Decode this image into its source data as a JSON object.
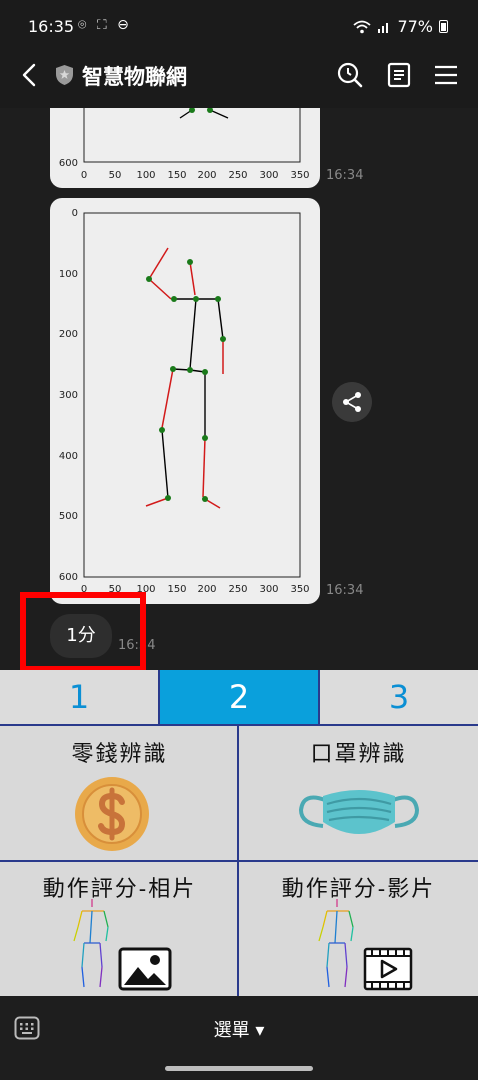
{
  "status_bar": {
    "time": "16:35",
    "left_icons": "⌾ ⛶ ⊖",
    "battery": "77%"
  },
  "header": {
    "title": "智慧物聯網",
    "icons": [
      "back-icon",
      "shield-icon",
      "search-history-icon",
      "notes-icon",
      "menu-icon"
    ]
  },
  "chat": {
    "messages": [
      {
        "type": "image",
        "time": "16:34",
        "x_ticks": [
          "0",
          "50",
          "100",
          "150",
          "200",
          "250",
          "300",
          "350"
        ],
        "y_ticks": [
          "600"
        ]
      },
      {
        "type": "image",
        "time": "16:34",
        "x_ticks": [
          "0",
          "50",
          "100",
          "150",
          "200",
          "250",
          "300",
          "350"
        ],
        "y_ticks": [
          "0",
          "100",
          "200",
          "300",
          "400",
          "500",
          "600"
        ]
      },
      {
        "type": "voice",
        "duration": "1分",
        "time": "16:34"
      }
    ]
  },
  "menu": {
    "tabs": [
      {
        "label": "1",
        "active": false
      },
      {
        "label": "2",
        "active": true
      },
      {
        "label": "3",
        "active": false
      }
    ],
    "items": [
      {
        "label": "零錢辨識",
        "icon": "coin-icon"
      },
      {
        "label": "口罩辨識",
        "icon": "face-mask-icon"
      },
      {
        "label": "動作評分-相片",
        "icon": "photo-icon"
      },
      {
        "label": "動作評分-影片",
        "icon": "video-icon"
      }
    ]
  },
  "bottom_bar": {
    "menu_label": "選單 ▾"
  },
  "colors": {
    "tab_active": "#0aa0dc",
    "tab_text": "#0b8fd4",
    "grid_line": "#2a3a8c",
    "highlight": "#ff0000",
    "coin": "#e8a94a",
    "mask": "#5cc3cc"
  }
}
